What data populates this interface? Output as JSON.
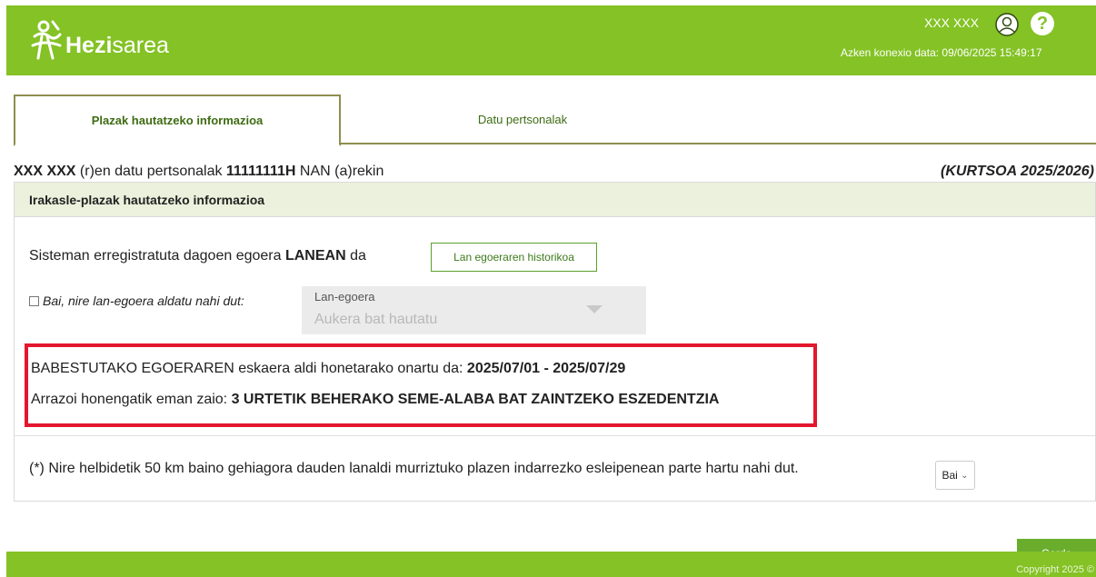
{
  "header": {
    "brand_bold": "Hezi",
    "brand_rest": "sarea",
    "user_name": "XXX XXX",
    "last_login": "Azken konexio data: 09/06/2025 15:49:17",
    "help_glyph": "?",
    "color": "#84c225"
  },
  "tabs": [
    {
      "label": "Plazak hautatzeko informazioa",
      "active": true
    },
    {
      "label": "Datu pertsonalak",
      "active": false
    }
  ],
  "title": {
    "name": "XXX XXX",
    "mid": " (r)en datu pertsonalak ",
    "id": "11111111H",
    "suffix": " NAN (a)rekin",
    "course": "(KURTSOA 2025/2026)"
  },
  "panel": {
    "heading": "Irakasle-plazak hautatzeko informazioa",
    "status_prefix": "Sisteman erregistratuta dagoen egoera ",
    "status_value": "LANEAN",
    "status_suffix": " da",
    "history_button": "Lan egoeraren historikoa",
    "checkbox_label": "Bai, nire lan-egoera aldatu nahi dut:",
    "select_label": "Lan-egoera",
    "select_placeholder": "Aukera bat hautatu",
    "protected_prefix": "BABESTUTAKO EGOERAREN eskaera aldi honetarako onartu da: ",
    "protected_dates": "2025/07/01 - 2025/07/29",
    "reason_prefix": "Arrazoi honengatik eman zaio: ",
    "reason_value": "3 URTETIK BEHERAKO SEME-ALABA BAT ZAINTZEKO ESZEDENTZIA",
    "question": "(*) Nire helbidetik 50 km baino gehiagora dauden lanaldi murriztuko plazen indarrezko esleipenean parte hartu nahi dut.",
    "answer": "Bai",
    "answer_caret": "⌄"
  },
  "actions": {
    "save": "Gorde"
  },
  "footer": {
    "copyright": "Copyright 2025 ©"
  },
  "colors": {
    "highlight": "#e3172d",
    "panel_head": "#ebf1dc"
  }
}
